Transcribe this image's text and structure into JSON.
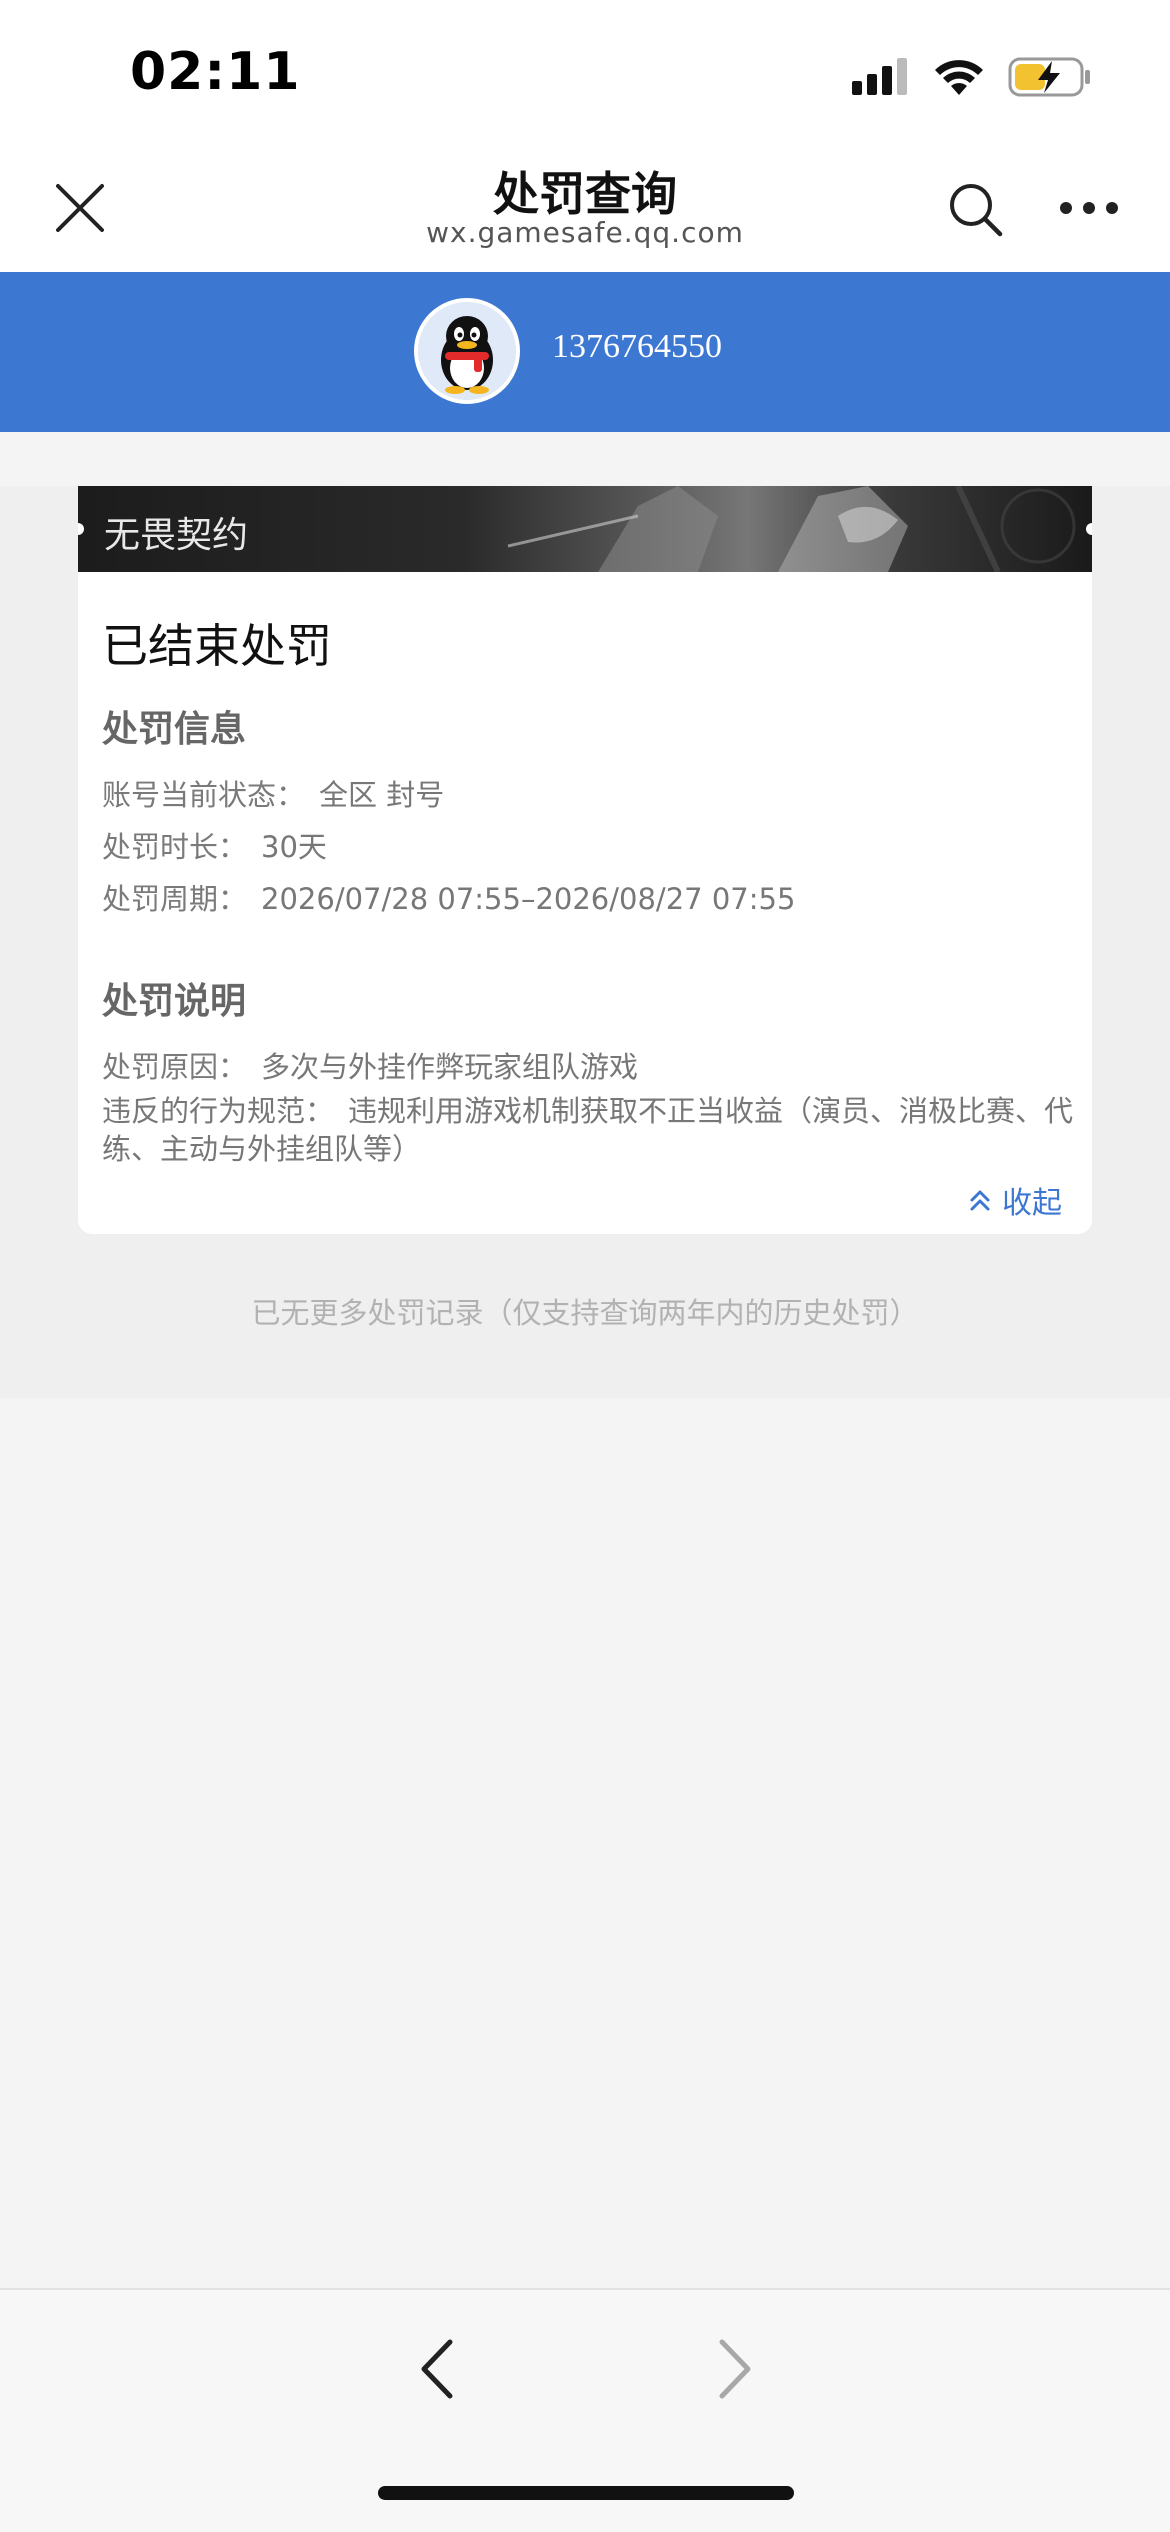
{
  "status_bar": {
    "time": "02:11"
  },
  "nav": {
    "title": "处罚查询",
    "url": "wx.gamesafe.qq.com"
  },
  "account": {
    "id": "1376764550"
  },
  "card": {
    "game_name": "无畏契约",
    "status": "已结束处罚",
    "penalty_info": {
      "title": "处罚信息",
      "account_status_label": "账号当前状态：",
      "account_status_value": "全区 封号",
      "duration_label": "处罚时长：",
      "duration_value": "30天",
      "period_label": "处罚周期：",
      "period_value": "2026/07/28 07:55–2026/08/27 07:55"
    },
    "penalty_explanation": {
      "title": "处罚说明",
      "reason_label": "处罚原因：",
      "reason_value": "多次与外挂作弊玩家组队游戏",
      "violation_label": "违反的行为规范：",
      "violation_value": "违规利用游戏机制获取不正当收益（演员、消极比赛、代练、主动与外挂组队等）"
    },
    "collapse_label": "收起"
  },
  "footer_note": "已无更多处罚记录（仅支持查询两年内的历史处罚）",
  "colors": {
    "brand_blue": "#3c77d2",
    "page_bg": "#f4f4f4"
  },
  "icons": {
    "close": "close-icon",
    "search": "search-icon",
    "more": "more-icon",
    "collapse": "double-chevron-up-icon",
    "back": "chevron-left-icon",
    "forward": "chevron-right-icon"
  }
}
